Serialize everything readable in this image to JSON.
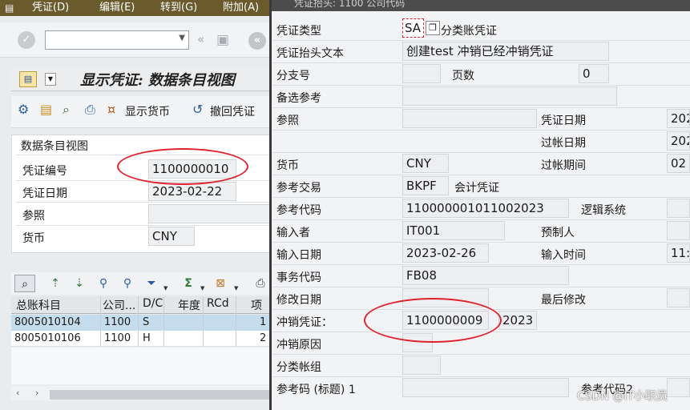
{
  "menubar": {
    "items": [
      "凭证(D)",
      "编辑(E)",
      "转到(G)",
      "附加(A)"
    ]
  },
  "page": {
    "title": "显示凭证: 数据条目视图"
  },
  "toolbar": {
    "show_currency_label": "显示货币",
    "reverse_doc_label": "撤回凭证"
  },
  "header_pane": {
    "section_title": "数据条目视图",
    "fields": [
      {
        "label": "凭证编号",
        "value": "1100000010"
      },
      {
        "label": "凭证日期",
        "value": "2023-02-22"
      },
      {
        "label": "参照",
        "value": ""
      },
      {
        "label": "货币",
        "value": "CNY"
      }
    ]
  },
  "line_items": {
    "columns": [
      "总账科目",
      "公司...",
      "D/C",
      "年度",
      "RCd",
      "项"
    ],
    "rows": [
      {
        "account": "8005010104",
        "company": "1100",
        "dc": "S",
        "item": "1"
      },
      {
        "account": "8005010106",
        "company": "1100",
        "dc": "H",
        "item": "2"
      }
    ]
  },
  "dialog": {
    "title": "凭证抬头: 1100 公司代码",
    "fields": {
      "doc_type": {
        "label": "凭证类型",
        "value": "SA",
        "desc": "分类账凭证"
      },
      "header_text": {
        "label": "凭证抬头文本",
        "value": "创建test 冲销已经冲销凭证"
      },
      "branch": {
        "label": "分支号",
        "value": ""
      },
      "pages": {
        "label": "页数",
        "value": "0"
      },
      "alt_ref": {
        "label": "备选参考",
        "value": ""
      },
      "reference": {
        "label": "参照",
        "value": ""
      },
      "doc_date": {
        "label": "凭证日期",
        "value": "202"
      },
      "posting_date": {
        "label": "过帐日期",
        "value": "202"
      },
      "currency": {
        "label": "货币",
        "value": "CNY"
      },
      "posting_period": {
        "label": "过帐期间",
        "value": "02"
      },
      "ref_trans": {
        "label": "参考交易",
        "value": "BKPF",
        "desc": "会计凭证"
      },
      "ref_key": {
        "label": "参考代码",
        "value": "110000001011002023"
      },
      "logical_system": {
        "label": "逻辑系统",
        "value": ""
      },
      "entered_by": {
        "label": "输入者",
        "value": "IT001"
      },
      "parked_by": {
        "label": "预制人",
        "value": ""
      },
      "entry_date": {
        "label": "输入日期",
        "value": "2023-02-26"
      },
      "entry_time": {
        "label": "输入时间",
        "value": "11:"
      },
      "tcode": {
        "label": "事务代码",
        "value": "FB08"
      },
      "changed_on": {
        "label": "修改日期",
        "value": ""
      },
      "last_change": {
        "label": "最后修改",
        "value": ""
      },
      "reversal_doc": {
        "label": "冲销凭证：",
        "value": "1100000009",
        "year": "2023"
      },
      "reversal_reason": {
        "label": "冲销原因",
        "value": ""
      },
      "ledger_group": {
        "label": "分类帐组",
        "value": ""
      },
      "ref_key_header": {
        "label": "参考码 (标题) 1",
        "value": ""
      },
      "ref_key_2": {
        "label": "参考代码2",
        "value": ""
      }
    }
  },
  "watermark": "CSDN @IT小职员",
  "colors": {
    "menubar": "#6a5a2c",
    "annotation": "#e0222c",
    "selected_row": "#c5dcec"
  }
}
